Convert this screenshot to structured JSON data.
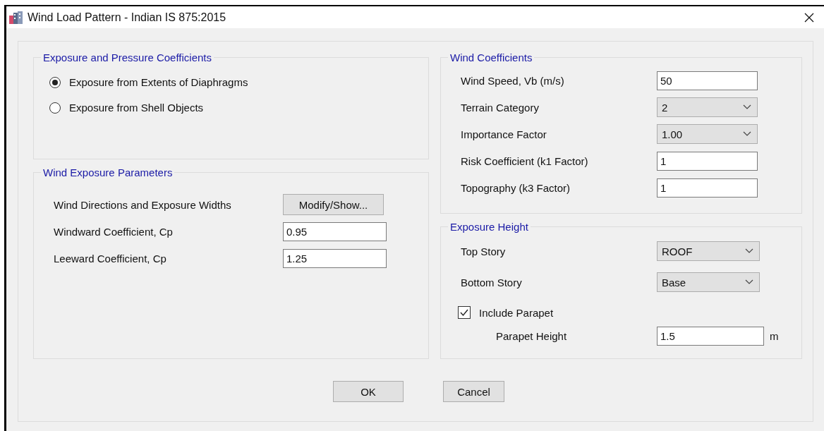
{
  "window": {
    "title": "Wind Load Pattern - Indian IS 875:2015"
  },
  "exposure_pressure": {
    "title": "Exposure and Pressure Coefficients",
    "options": [
      {
        "label": "Exposure from Extents of Diaphragms",
        "selected": true
      },
      {
        "label": "Exposure from Shell Objects",
        "selected": false
      }
    ]
  },
  "wind_exposure_parameters": {
    "title": "Wind Exposure Parameters",
    "rows": [
      {
        "kind": "button",
        "label": "Wind Directions and Exposure Widths",
        "button": "Modify/Show..."
      },
      {
        "kind": "input",
        "label": "Windward Coefficient, Cp",
        "value": "0.95"
      },
      {
        "kind": "input",
        "label": "Leeward Coefficient, Cp",
        "value": "1.25"
      }
    ]
  },
  "wind_coefficients": {
    "title": "Wind Coefficients",
    "rows": [
      {
        "kind": "input",
        "label": "Wind Speed, Vb (m/s)",
        "value": "50"
      },
      {
        "kind": "dropdown",
        "label": "Terrain Category",
        "value": "2"
      },
      {
        "kind": "dropdown",
        "label": "Importance Factor",
        "value": "1.00"
      },
      {
        "kind": "input",
        "label": "Risk Coefficient (k1 Factor)",
        "value": "1"
      },
      {
        "kind": "input",
        "label": "Topography (k3 Factor)",
        "value": "1"
      }
    ]
  },
  "exposure_height": {
    "title": "Exposure Height",
    "rows": [
      {
        "kind": "dropdown",
        "label": "Top Story",
        "value": "ROOF"
      },
      {
        "kind": "dropdown",
        "label": "Bottom Story",
        "value": "Base"
      },
      {
        "kind": "checkbox",
        "label": "Include Parapet",
        "checked": true,
        "children": [
          {
            "kind": "input",
            "label": "Parapet Height",
            "value": "1.5",
            "unit": "m"
          }
        ]
      }
    ]
  },
  "buttons": [
    "OK",
    "Cancel"
  ]
}
